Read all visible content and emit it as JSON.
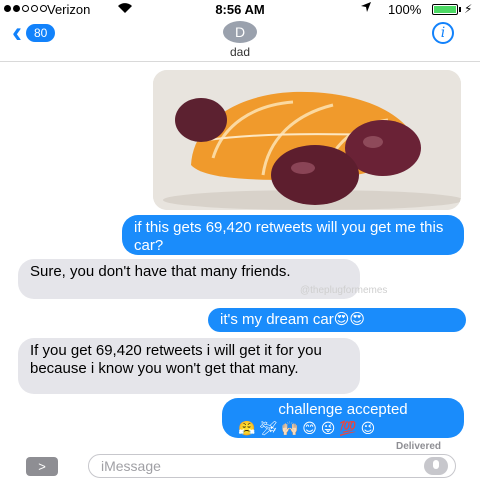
{
  "status": {
    "carrier": "Verizon",
    "time": "8:56 AM",
    "battery": "100%"
  },
  "nav": {
    "back_count": "80",
    "avatar_initial": "D",
    "contact_name": "dad",
    "info_label": "i"
  },
  "thread": {
    "messages": [
      {
        "from": "me",
        "text": "if this gets 69,420 retweets will you get me this car?"
      },
      {
        "from": "dad",
        "text": "Sure, you don't have that many friends."
      },
      {
        "from": "me",
        "text": "it's my dream car😍😍"
      },
      {
        "from": "dad",
        "text": "If you get 69,420 retweets i will get it for you because i know you won't get that many."
      },
      {
        "from": "me",
        "text": "challenge accepted",
        "emojis": "😤 🛩 🙌🏻 😊 😜 💯 😉"
      }
    ],
    "watermark": "@theplugformemes",
    "delivered": "Delivered"
  },
  "input": {
    "expand_label": ">",
    "placeholder": "iMessage"
  },
  "colors": {
    "accent": "#1282fb",
    "outgoing": "#1a8cfb",
    "incoming": "#e5e5ea"
  }
}
